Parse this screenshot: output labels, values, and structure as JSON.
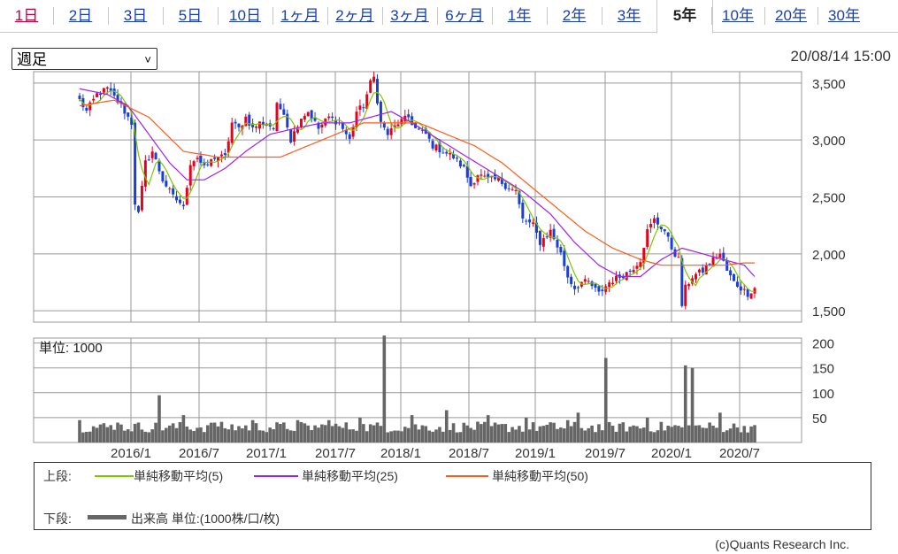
{
  "tabs": [
    "1日",
    "2日",
    "3日",
    "5日",
    "10日",
    "1ヶ月",
    "2ヶ月",
    "3ヶ月",
    "6ヶ月",
    "1年",
    "2年",
    "3年",
    "5年",
    "10年",
    "20年",
    "30年"
  ],
  "active_tab": "5年",
  "period_select": {
    "value": "週足"
  },
  "timestamp": "20/08/14 15:00",
  "volume_unit_label": "単位: 1000",
  "legend": {
    "upper_label": "上段:",
    "lower_label": "下段:",
    "ma5": "単純移動平均(5)",
    "ma25": "単純移動平均(25)",
    "ma50": "単純移動平均(50)",
    "volume": "出来高 単位:(1000株/口/枚)"
  },
  "credit": "(c)Quants Research Inc.",
  "colors": {
    "up": "#e8001c",
    "down": "#1a3fd8",
    "ma5": "#7cc800",
    "ma25": "#a020f0",
    "ma50": "#ff5a1a",
    "volume": "#666666"
  },
  "chart_data": [
    {
      "type": "candlestick",
      "ylim": [
        1400,
        3600
      ],
      "yticks": [
        1500,
        2000,
        2500,
        3000,
        3500
      ],
      "ytick_labels": [
        "1,500",
        "2,000",
        "2,500",
        "3,000",
        "3,500"
      ],
      "xtick_labels": [
        "2016/1",
        "2016/7",
        "2017/1",
        "2017/7",
        "2018/1",
        "2018/7",
        "2019/1",
        "2019/7",
        "2020/1",
        "2020/7"
      ],
      "grid": true,
      "approx_close_trajectory": [
        [
          0,
          3350
        ],
        [
          2,
          3250
        ],
        [
          5,
          3400
        ],
        [
          8,
          3450
        ],
        [
          12,
          3300
        ],
        [
          15,
          3150
        ],
        [
          16,
          2450
        ],
        [
          17,
          2350
        ],
        [
          19,
          2800
        ],
        [
          21,
          2900
        ],
        [
          24,
          2650
        ],
        [
          27,
          2500
        ],
        [
          29,
          2450
        ],
        [
          30,
          2400
        ],
        [
          32,
          2800
        ],
        [
          34,
          2850
        ],
        [
          36,
          2750
        ],
        [
          39,
          2850
        ],
        [
          42,
          2850
        ],
        [
          44,
          3150
        ],
        [
          46,
          3100
        ],
        [
          48,
          3200
        ],
        [
          50,
          3100
        ],
        [
          52,
          3150
        ],
        [
          54,
          3150
        ],
        [
          56,
          3100
        ],
        [
          57,
          3300
        ],
        [
          59,
          3250
        ],
        [
          61,
          3000
        ],
        [
          64,
          3200
        ],
        [
          66,
          3250
        ],
        [
          69,
          3100
        ],
        [
          72,
          3200
        ],
        [
          75,
          3150
        ],
        [
          78,
          3000
        ],
        [
          80,
          3250
        ],
        [
          82,
          3300
        ],
        [
          84,
          3500
        ],
        [
          85,
          3550
        ],
        [
          87,
          3150
        ],
        [
          89,
          3050
        ],
        [
          92,
          3150
        ],
        [
          95,
          3200
        ],
        [
          97,
          3100
        ],
        [
          100,
          3050
        ],
        [
          102,
          2950
        ],
        [
          105,
          2900
        ],
        [
          108,
          2850
        ],
        [
          111,
          2750
        ],
        [
          113,
          2600
        ],
        [
          115,
          2700
        ],
        [
          118,
          2650
        ],
        [
          121,
          2650
        ],
        [
          123,
          2600
        ],
        [
          126,
          2550
        ],
        [
          128,
          2300
        ],
        [
          131,
          2250
        ],
        [
          133,
          2100
        ],
        [
          136,
          2200
        ],
        [
          139,
          2000
        ],
        [
          141,
          1800
        ],
        [
          143,
          1700
        ],
        [
          145,
          1750
        ],
        [
          147,
          1750
        ],
        [
          150,
          1650
        ],
        [
          153,
          1750
        ],
        [
          156,
          1800
        ],
        [
          159,
          1850
        ],
        [
          162,
          1950
        ],
        [
          164,
          2200
        ],
        [
          166,
          2300
        ],
        [
          169,
          2200
        ],
        [
          171,
          2050
        ],
        [
          173,
          1950
        ],
        [
          174,
          1550
        ],
        [
          175,
          1700
        ],
        [
          177,
          1800
        ],
        [
          180,
          1850
        ],
        [
          183,
          1950
        ],
        [
          185,
          2000
        ],
        [
          187,
          1850
        ],
        [
          189,
          1750
        ],
        [
          191,
          1700
        ],
        [
          193,
          1650
        ],
        [
          195,
          1700
        ]
      ],
      "approx_ma25": [
        [
          0,
          3450
        ],
        [
          8,
          3400
        ],
        [
          14,
          3300
        ],
        [
          20,
          3050
        ],
        [
          26,
          2800
        ],
        [
          31,
          2650
        ],
        [
          36,
          2650
        ],
        [
          42,
          2750
        ],
        [
          48,
          2900
        ],
        [
          55,
          3050
        ],
        [
          62,
          3100
        ],
        [
          70,
          3150
        ],
        [
          78,
          3150
        ],
        [
          84,
          3200
        ],
        [
          90,
          3250
        ],
        [
          96,
          3150
        ],
        [
          104,
          3000
        ],
        [
          112,
          2850
        ],
        [
          120,
          2700
        ],
        [
          128,
          2550
        ],
        [
          136,
          2350
        ],
        [
          143,
          2100
        ],
        [
          150,
          1900
        ],
        [
          156,
          1800
        ],
        [
          162,
          1800
        ],
        [
          168,
          1950
        ],
        [
          174,
          2050
        ],
        [
          180,
          2000
        ],
        [
          186,
          1950
        ],
        [
          192,
          1900
        ],
        [
          195,
          1800
        ]
      ],
      "approx_ma50": [
        [
          0,
          3300
        ],
        [
          10,
          3350
        ],
        [
          20,
          3200
        ],
        [
          30,
          2900
        ],
        [
          40,
          2850
        ],
        [
          50,
          2850
        ],
        [
          58,
          2850
        ],
        [
          66,
          2950
        ],
        [
          74,
          3050
        ],
        [
          82,
          3150
        ],
        [
          90,
          3150
        ],
        [
          98,
          3150
        ],
        [
          106,
          3050
        ],
        [
          114,
          2950
        ],
        [
          122,
          2800
        ],
        [
          130,
          2600
        ],
        [
          138,
          2400
        ],
        [
          146,
          2200
        ],
        [
          154,
          2050
        ],
        [
          162,
          1950
        ],
        [
          168,
          1900
        ],
        [
          174,
          1900
        ],
        [
          180,
          1900
        ],
        [
          186,
          1900
        ],
        [
          192,
          1920
        ],
        [
          195,
          1920
        ]
      ]
    },
    {
      "type": "bar",
      "title": "出来高",
      "ylim": [
        0,
        210
      ],
      "yticks": [
        50,
        100,
        150,
        200
      ],
      "ytick_labels": [
        "50",
        "100",
        "150",
        "200"
      ],
      "grid": true,
      "approx_volume_spikes": [
        [
          0,
          45
        ],
        [
          11,
          40
        ],
        [
          23,
          95
        ],
        [
          30,
          55
        ],
        [
          39,
          40
        ],
        [
          50,
          45
        ],
        [
          63,
          45
        ],
        [
          72,
          45
        ],
        [
          81,
          50
        ],
        [
          88,
          215
        ],
        [
          96,
          55
        ],
        [
          106,
          65
        ],
        [
          118,
          55
        ],
        [
          129,
          50
        ],
        [
          141,
          45
        ],
        [
          144,
          60
        ],
        [
          152,
          170
        ],
        [
          164,
          50
        ],
        [
          175,
          155
        ],
        [
          177,
          150
        ],
        [
          185,
          60
        ],
        [
          195,
          35
        ]
      ]
    }
  ]
}
